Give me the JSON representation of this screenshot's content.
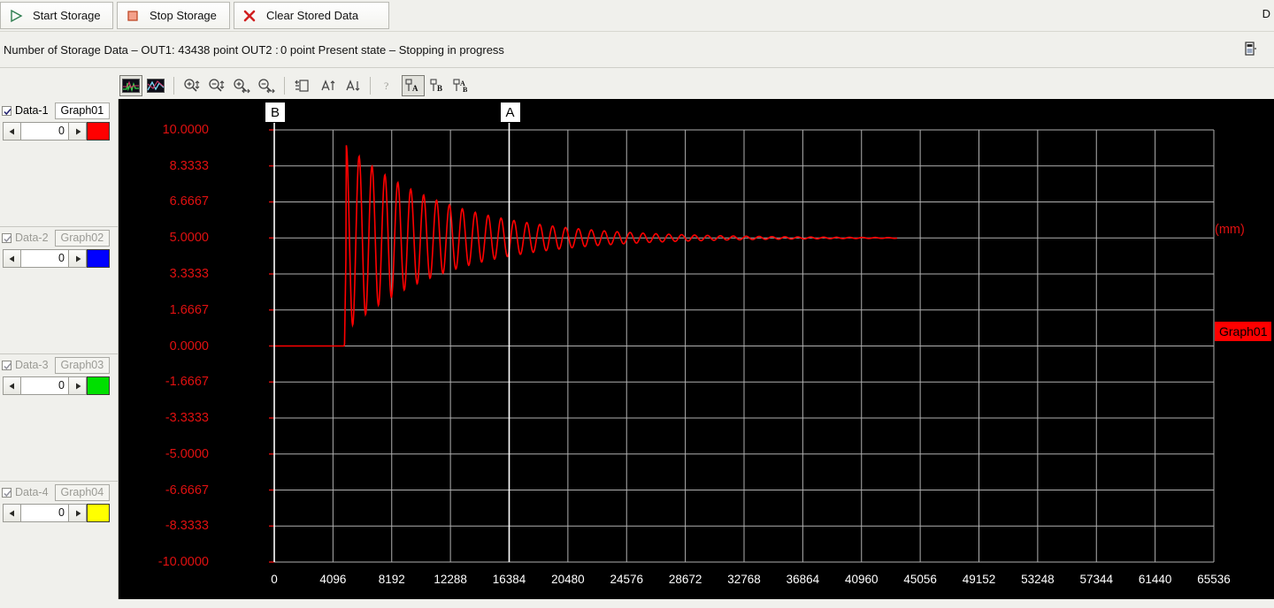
{
  "toolbar_top": {
    "buttons": [
      {
        "label": "Start Storage",
        "icon": "play-triangle-icon",
        "left": 0,
        "width": 128
      },
      {
        "label": "Stop Storage",
        "icon": "stop-square-icon",
        "left": 132,
        "width": 128
      },
      {
        "label": "Clear Stored Data",
        "icon": "red-cross-icon",
        "left": 264,
        "width": 176
      }
    ]
  },
  "status": {
    "left_text": "Number of Storage Data – OUT1: 43438 point OUT2 :",
    "right_text": "0 point Present state – Stopping in progress",
    "out1_points": "43438",
    "out2_points": "0",
    "present_state": "Stopping in progress",
    "dock_label": "D"
  },
  "graph_toolbar": {
    "items": [
      {
        "name": "graph-display-1-icon",
        "glyph": "thumb",
        "selected": true
      },
      {
        "name": "graph-display-2-icon",
        "glyph": "thumb2",
        "selected": false
      },
      {
        "name": "sep1",
        "glyph": "sep",
        "selected": false
      },
      {
        "name": "zoom-in-vertical-icon",
        "glyph": "zoom-plus-v",
        "selected": false
      },
      {
        "name": "zoom-out-vertical-icon",
        "glyph": "zoom-minus-v",
        "selected": false
      },
      {
        "name": "zoom-in-horizontal-icon",
        "glyph": "zoom-plus-h",
        "selected": false
      },
      {
        "name": "zoom-out-horizontal-icon",
        "glyph": "zoom-minus-h",
        "selected": false
      },
      {
        "name": "sep2",
        "glyph": "sep",
        "selected": false
      },
      {
        "name": "fit-scale-icon",
        "glyph": "fit",
        "selected": false
      },
      {
        "name": "scale-up-icon",
        "glyph": "a-up",
        "selected": false
      },
      {
        "name": "scale-down-icon",
        "glyph": "a-down",
        "selected": false
      },
      {
        "name": "sep3",
        "glyph": "sep",
        "selected": false
      },
      {
        "name": "help-cursor-icon",
        "glyph": "help",
        "selected": false
      },
      {
        "name": "cursor-a-icon",
        "glyph": "cur-a",
        "selected": true
      },
      {
        "name": "cursor-b-icon",
        "glyph": "cur-b",
        "selected": false
      },
      {
        "name": "cursor-ab-icon",
        "glyph": "cur-ab",
        "selected": false
      }
    ]
  },
  "data_channels": [
    {
      "name": "Data‑1",
      "graph": "Graph01",
      "value": "0",
      "color": "#ff0000",
      "enabled": true,
      "active": true
    },
    {
      "name": "Data‑2",
      "graph": "Graph02",
      "value": "0",
      "color": "#0000ff",
      "enabled": true,
      "active": false
    },
    {
      "name": "Data‑3",
      "graph": "Graph03",
      "value": "0",
      "color": "#00e000",
      "enabled": true,
      "active": false
    },
    {
      "name": "Data‑4",
      "graph": "Graph04",
      "value": "0",
      "color": "#ffff00",
      "enabled": true,
      "active": false
    }
  ],
  "graph": {
    "unit_label": "(mm)",
    "legend_label": "Graph01",
    "cursor_a_label": "A",
    "cursor_b_label": "B",
    "cursor_a_x": 16384,
    "cursor_b_x": 0,
    "background_color": "#000000",
    "grid_color": "#b0b0b0",
    "trace_color": "#ff0000",
    "axis_label_color": "#e01010"
  },
  "chart_data": {
    "type": "line",
    "title": "",
    "xlabel": "",
    "ylabel": "(mm)",
    "xlim": [
      0,
      65536
    ],
    "ylim": [
      -10.0,
      10.0
    ],
    "grid": true,
    "legend_position": "right",
    "xticks": [
      0,
      4096,
      8192,
      12288,
      16384,
      20480,
      24576,
      28672,
      32768,
      36864,
      40960,
      45056,
      49152,
      53248,
      57344,
      61440,
      65536
    ],
    "xtick_labels": [
      "0",
      "4096",
      "8192",
      "12288",
      "16384",
      "20480",
      "24576",
      "28672",
      "32768",
      "36864",
      "40960",
      "45056",
      "49152",
      "53248",
      "57344",
      "61440",
      "65536"
    ],
    "yticks": [
      10.0,
      8.3333,
      6.6667,
      5.0,
      3.3333,
      1.6667,
      0.0,
      -1.6667,
      -3.3333,
      -5.0,
      -6.6667,
      -8.3333,
      -10.0
    ],
    "ytick_labels": [
      "10.0000",
      "8.3333",
      "6.6667",
      "5.0000",
      "3.3333",
      "1.6667",
      "0.0000",
      "-1.6667",
      "-3.3333",
      "-5.0000",
      "-6.6667",
      "-8.3333",
      "-10.0000"
    ],
    "series": [
      {
        "name": "Graph01",
        "color": "#ff0000",
        "description": "Step response with underdamped decaying oscillation settling at 5.0 mm",
        "step_start_x": 4900,
        "settle_value": 5.0,
        "initial_value": 0.0,
        "first_peak": 9.3,
        "first_trough": 0.7,
        "oscillation_period_x": 900,
        "decay_time_constant_x": 7000,
        "trace_end_x": 43438
      }
    ]
  }
}
